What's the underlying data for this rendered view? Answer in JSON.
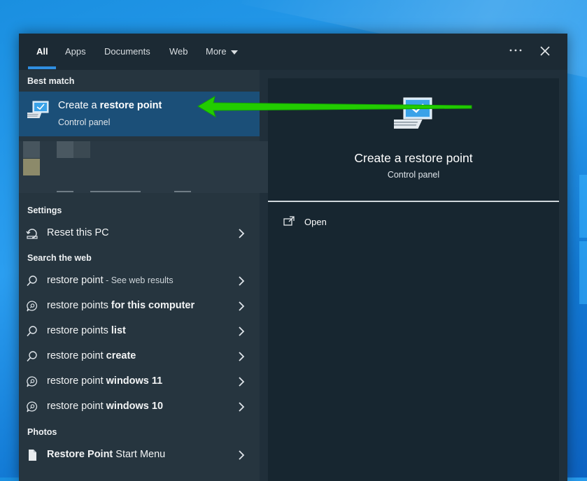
{
  "tabs": [
    {
      "label": "All"
    },
    {
      "label": "Apps"
    },
    {
      "label": "Documents"
    },
    {
      "label": "Web"
    },
    {
      "label": "More"
    }
  ],
  "sections": {
    "best_match": "Best match",
    "settings": "Settings",
    "search_web": "Search the web",
    "photos": "Photos"
  },
  "best_match": {
    "title_prefix": "Create a ",
    "title_bold": "restore point",
    "subtitle": "Control panel"
  },
  "settings_items": [
    {
      "label": "Reset this PC"
    }
  ],
  "web_items": [
    {
      "light": "restore point",
      "bold": "",
      "small": " - See web results",
      "icon": "search-icon"
    },
    {
      "light": "restore points ",
      "bold": "for this computer",
      "small": "",
      "icon": "chat-search-icon"
    },
    {
      "light": "restore points ",
      "bold": "list",
      "small": "",
      "icon": "search-icon"
    },
    {
      "light": "restore point ",
      "bold": "create",
      "small": "",
      "icon": "search-icon"
    },
    {
      "light": "restore point ",
      "bold": "windows 11",
      "small": "",
      "icon": "chat-search-icon"
    },
    {
      "light": "restore point ",
      "bold": "windows 10",
      "small": "",
      "icon": "chat-search-icon"
    }
  ],
  "photos_items": [
    {
      "bold": "Restore Point",
      "light": " Start Menu"
    }
  ],
  "preview": {
    "title": "Create a restore point",
    "subtitle": "Control panel",
    "action_open": "Open"
  },
  "colors": {
    "accent": "#2f8ee0",
    "selected_row": "#1b4f78",
    "annotation_arrow": "#22cc00"
  }
}
